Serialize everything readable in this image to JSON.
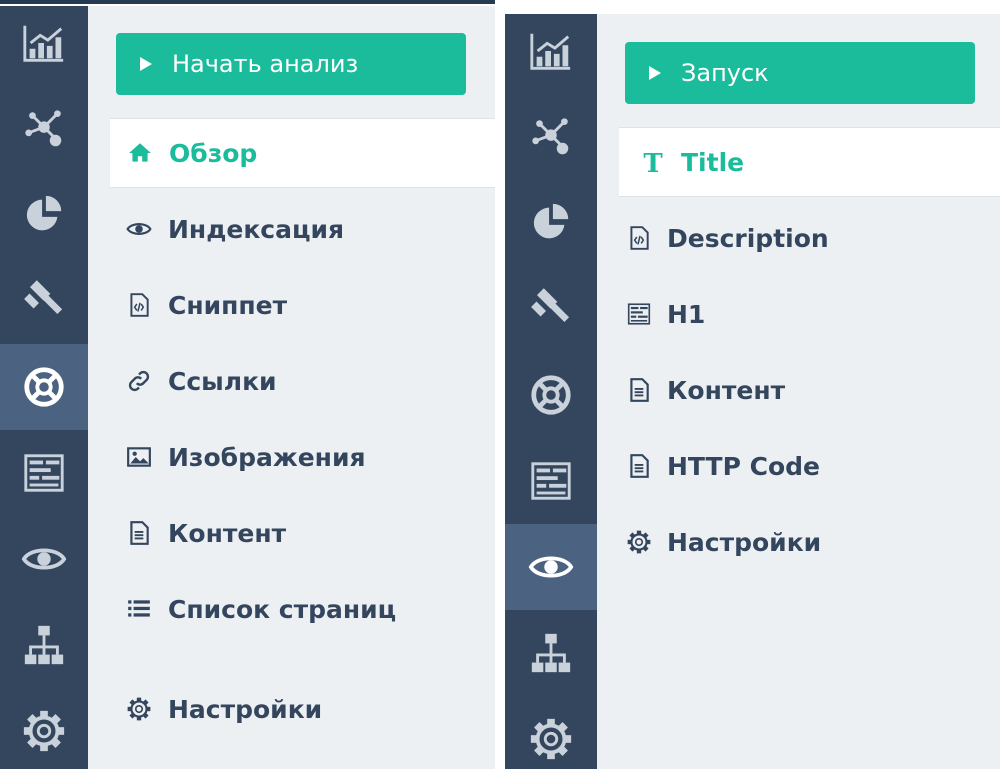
{
  "colors": {
    "accent": "#1abc9c",
    "rail": "#34465e",
    "rail_active": "#4b6380",
    "content_bg": "#edf0f2",
    "text": "#34465e"
  },
  "left": {
    "start_button": "Начать анализ",
    "rail_icons": [
      "chart-icon",
      "network-icon",
      "pie-chart-icon",
      "gavel-icon",
      "lifebuoy-icon",
      "dashboard-icon",
      "eye-icon",
      "sitemap-icon",
      "gear-icon"
    ],
    "rail_active_index": 4,
    "nav": [
      {
        "label": "Обзор",
        "icon": "home-icon",
        "active": true
      },
      {
        "label": "Индексация",
        "icon": "eye-icon"
      },
      {
        "label": "Сниппет",
        "icon": "code-file-icon"
      },
      {
        "label": "Ссылки",
        "icon": "link-icon"
      },
      {
        "label": "Изображения",
        "icon": "image-icon"
      },
      {
        "label": "Контент",
        "icon": "document-icon"
      },
      {
        "label": "Список страниц",
        "icon": "list-icon"
      },
      {
        "label": "Настройки",
        "icon": "gear-icon"
      }
    ]
  },
  "right": {
    "start_button": "Запуск",
    "rail_icons": [
      "chart-icon",
      "network-icon",
      "pie-chart-icon",
      "gavel-icon",
      "lifebuoy-icon",
      "dashboard-icon",
      "eye-icon",
      "sitemap-icon",
      "gear-icon"
    ],
    "rail_active_index": 6,
    "nav": [
      {
        "label": "Title",
        "icon": "title-icon",
        "active": true
      },
      {
        "label": "Description",
        "icon": "code-file-icon"
      },
      {
        "label": "H1",
        "icon": "dashboard-icon"
      },
      {
        "label": "Контент",
        "icon": "document-icon"
      },
      {
        "label": "HTTP Code",
        "icon": "document-icon"
      },
      {
        "label": "Настройки",
        "icon": "gear-icon"
      }
    ]
  }
}
